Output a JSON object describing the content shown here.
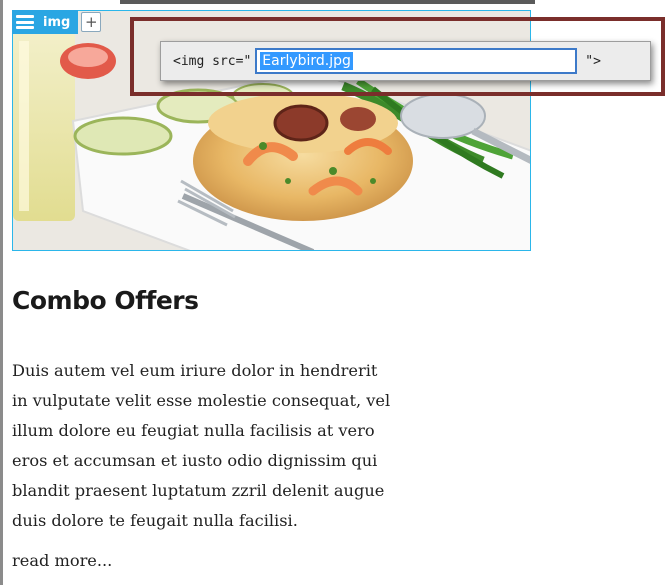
{
  "element_toolbar": {
    "tag_label": "img",
    "menu_icon": "hamburger-menu-icon",
    "add_label": "+"
  },
  "src_editor": {
    "prefix": "<img src=\"",
    "value": "Earlybird.jpg",
    "suffix": "\">"
  },
  "content": {
    "heading": "Combo Offers",
    "body": "Duis autem vel eum iriure dolor in hendrerit\nin vulputate velit esse molestie consequat, vel\nillum dolore eu feugiat nulla facilisis at vero\neros et accumsan et iusto odio dignissim qui\nblandit praesent luptatum zzril delenit augue\nduis dolore te feugait nulla facilisi.",
    "read_more": "read more..."
  },
  "colors": {
    "selection_outline": "#2bb6ea",
    "toolbar_blue": "#2aa6e3",
    "highlight_red": "#7a2e2b"
  }
}
